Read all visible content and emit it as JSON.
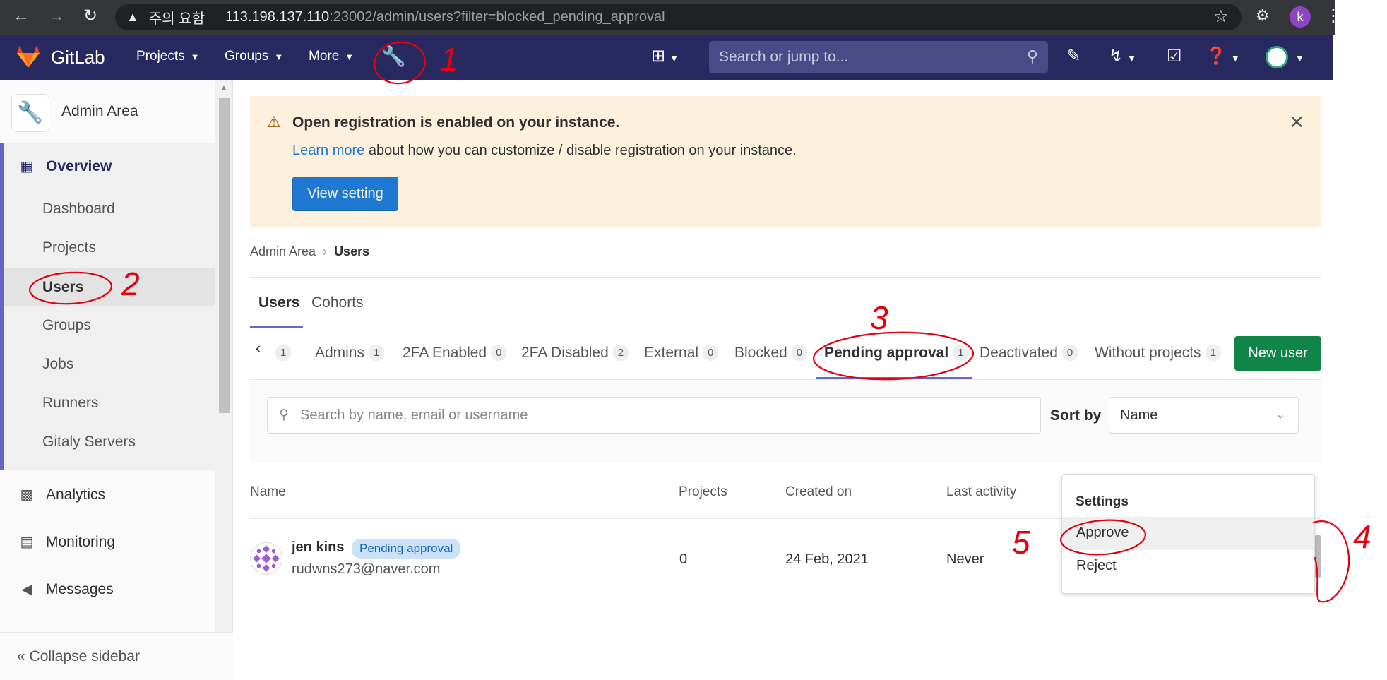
{
  "browser": {
    "warning_label": "주의 요함",
    "url_host": "113.198.137.110",
    "url_path": ":23002/admin/users?filter=blocked_pending_approval",
    "profile_initial": "k"
  },
  "header": {
    "brand": "GitLab",
    "nav": [
      "Projects",
      "Groups",
      "More"
    ],
    "search_placeholder": "Search or jump to..."
  },
  "sidebar": {
    "title": "Admin Area",
    "section_overview": "Overview",
    "items": [
      "Dashboard",
      "Projects",
      "Users",
      "Groups",
      "Jobs",
      "Runners",
      "Gitaly Servers"
    ],
    "section_analytics": "Analytics",
    "section_monitoring": "Monitoring",
    "section_messages": "Messages",
    "collapse_label": "Collapse sidebar"
  },
  "banner": {
    "title": "Open registration is enabled on your instance.",
    "link_text": "Learn more",
    "body_text": " about how you can customize / disable registration on your instance.",
    "button_label": "View setting"
  },
  "breadcrumb": {
    "parent": "Admin Area",
    "current": "Users"
  },
  "tabs": [
    "Users",
    "Cohorts"
  ],
  "filter_tabs": [
    {
      "label": "",
      "count": "1"
    },
    {
      "label": "Admins",
      "count": "1"
    },
    {
      "label": "2FA Enabled",
      "count": "0"
    },
    {
      "label": "2FA Disabled",
      "count": "2"
    },
    {
      "label": "External",
      "count": "0"
    },
    {
      "label": "Blocked",
      "count": "0"
    },
    {
      "label": "Pending approval",
      "count": "1"
    },
    {
      "label": "Deactivated",
      "count": "0"
    },
    {
      "label": "Without projects",
      "count": "1"
    }
  ],
  "new_user_label": "New user",
  "search_users_placeholder": "Search by name, email or username",
  "sort": {
    "label": "Sort by",
    "value": "Name"
  },
  "table": {
    "headers": [
      "Name",
      "Projects",
      "Created on",
      "Last activity"
    ],
    "rows": [
      {
        "name": "jen kins",
        "badge": "Pending approval",
        "email": "rudwns273@naver.com",
        "projects": "0",
        "created_on": "24 Feb, 2021",
        "last_activity": "Never"
      }
    ]
  },
  "dropdown": {
    "header": "Settings",
    "items": [
      "Approve",
      "Reject"
    ]
  },
  "annotations": [
    "1",
    "2",
    "3",
    "4",
    "5"
  ],
  "colors": {
    "header_bg": "#292961",
    "accent": "#6666c4",
    "primary_button": "#1f78d1",
    "success_button": "#108548",
    "annotation_red": "#e3000f"
  }
}
